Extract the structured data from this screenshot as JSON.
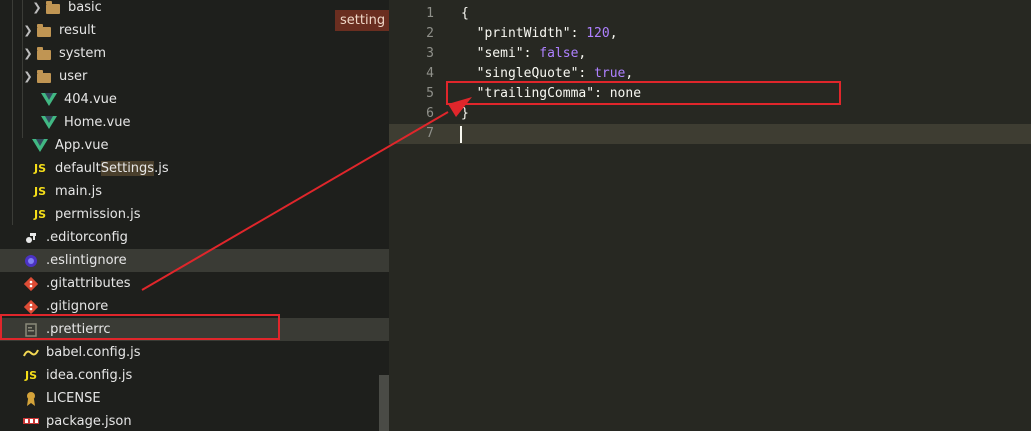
{
  "sidebar": {
    "items": [
      {
        "label": "basic",
        "kind": "folder",
        "chevron": "›"
      },
      {
        "label": "result",
        "kind": "folder",
        "chevron": "›"
      },
      {
        "label": "system",
        "kind": "folder",
        "chevron": "›"
      },
      {
        "label": "user",
        "kind": "folder",
        "chevron": "›"
      },
      {
        "label": "404.vue",
        "kind": "vue"
      },
      {
        "label": "Home.vue",
        "kind": "vue"
      },
      {
        "label": "App.vue",
        "kind": "vue"
      },
      {
        "label_pre": "default",
        "label_match": "Settings",
        "label_post": ".js",
        "kind": "js",
        "js_text": "JS"
      },
      {
        "label": "main.js",
        "kind": "js",
        "js_text": "JS"
      },
      {
        "label": "permission.js",
        "kind": "js",
        "js_text": "JS"
      },
      {
        "label": ".editorconfig",
        "kind": "editorconfig"
      },
      {
        "label": ".eslintignore",
        "kind": "eslint"
      },
      {
        "label": ".gitattributes",
        "kind": "git"
      },
      {
        "label": ".gitignore",
        "kind": "git"
      },
      {
        "label": ".prettierrc",
        "kind": "prettier"
      },
      {
        "label": "babel.config.js",
        "kind": "babel"
      },
      {
        "label": "idea.config.js",
        "kind": "js",
        "js_text": "JS"
      },
      {
        "label": "LICENSE",
        "kind": "license"
      },
      {
        "label": "package.json",
        "kind": "npm"
      }
    ],
    "search_tag": "setting"
  },
  "editor": {
    "line_numbers": [
      "1",
      "2",
      "3",
      "4",
      "5",
      "6",
      "7"
    ],
    "lines": {
      "l1": "{",
      "l2_key": "\"printWidth\"",
      "l2_sep": ": ",
      "l2_val": "120",
      "l2_end": ",",
      "l3_key": "\"semi\"",
      "l3_sep": ": ",
      "l3_val": "false",
      "l3_end": ",",
      "l4_key": "\"singleQuote\"",
      "l4_sep": ": ",
      "l4_val": "true",
      "l4_end": ",",
      "l5_key": "\"trailingComma\"",
      "l5_sep": ": ",
      "l5_val": "none",
      "l6": "}",
      "l7": ""
    }
  },
  "colors": {
    "annotation_red": "#e0262b",
    "editor_bg": "#272822",
    "sidebar_bg": "#1e1f1c"
  },
  "icons": {
    "folder": "folder-icon",
    "vue": "vue-icon",
    "js": "js-icon",
    "git": "git-icon",
    "eslint": "eslint-icon",
    "editorconfig": "editorconfig-icon",
    "prettier": "prettier-icon",
    "babel": "babel-icon",
    "license": "license-icon",
    "npm": "npm-icon"
  }
}
